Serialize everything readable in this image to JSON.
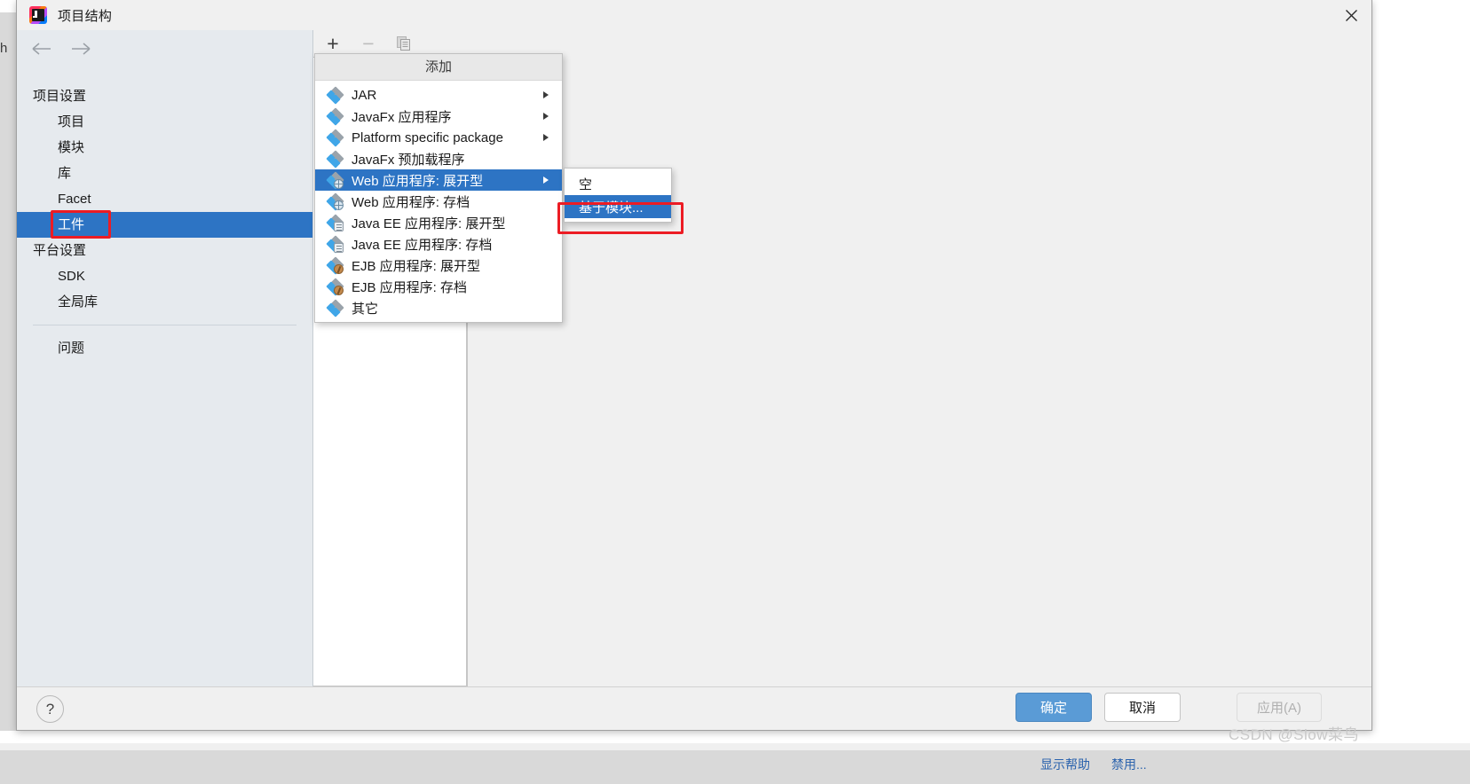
{
  "window": {
    "title": "项目结构",
    "app_icon": "intellij-idea-icon",
    "close_label": "✕"
  },
  "sidebar": {
    "back_icon": "arrow-left-icon",
    "forward_icon": "arrow-right-icon",
    "groups": [
      {
        "label": "项目设置",
        "items": [
          {
            "label": "项目",
            "selected": false
          },
          {
            "label": "模块",
            "selected": false
          },
          {
            "label": "库",
            "selected": false
          },
          {
            "label": "Facet",
            "selected": false
          },
          {
            "label": "工件",
            "selected": true,
            "highlight": "red-box"
          }
        ]
      },
      {
        "label": "平台设置",
        "items": [
          {
            "label": "SDK",
            "selected": false
          },
          {
            "label": "全局库",
            "selected": false
          }
        ]
      }
    ],
    "footer_items": [
      {
        "label": "问题",
        "selected": false
      }
    ]
  },
  "toolbar": {
    "add_icon": "plus-icon",
    "add_label": "+",
    "remove_icon": "minus-icon",
    "remove_label": "−",
    "copy_icon": "copy-icon"
  },
  "menu": {
    "header": "添加",
    "items": [
      {
        "label": "JAR",
        "icon": "artifact-icon",
        "badge": "none",
        "has_submenu": true,
        "selected": false
      },
      {
        "label": "JavaFx 应用程序",
        "icon": "artifact-icon",
        "badge": "none",
        "has_submenu": true,
        "selected": false
      },
      {
        "label": "Platform specific package",
        "icon": "artifact-icon",
        "badge": "none",
        "has_submenu": true,
        "selected": false
      },
      {
        "label": "JavaFx 预加载程序",
        "icon": "artifact-icon",
        "badge": "none",
        "has_submenu": false,
        "selected": false
      },
      {
        "label": "Web 应用程序: 展开型",
        "icon": "artifact-web-icon",
        "badge": "globe",
        "has_submenu": true,
        "selected": true
      },
      {
        "label": "Web 应用程序: 存档",
        "icon": "artifact-web-icon",
        "badge": "globe",
        "has_submenu": false,
        "selected": false
      },
      {
        "label": "Java EE 应用程序: 展开型",
        "icon": "artifact-javaee-icon",
        "badge": "ee",
        "has_submenu": false,
        "selected": false
      },
      {
        "label": "Java EE 应用程序: 存档",
        "icon": "artifact-javaee-icon",
        "badge": "ee",
        "has_submenu": false,
        "selected": false
      },
      {
        "label": "EJB 应用程序: 展开型",
        "icon": "artifact-ejb-icon",
        "badge": "bean",
        "has_submenu": false,
        "selected": false
      },
      {
        "label": "EJB 应用程序: 存档",
        "icon": "artifact-ejb-icon",
        "badge": "bean",
        "has_submenu": false,
        "selected": false
      },
      {
        "label": "其它",
        "icon": "artifact-icon",
        "badge": "none",
        "has_submenu": false,
        "selected": false
      }
    ]
  },
  "submenu": {
    "items": [
      {
        "label": "空",
        "selected": false
      },
      {
        "label": "基于模块...",
        "selected": true,
        "highlight": "red-box"
      }
    ]
  },
  "footer": {
    "help_label": "?",
    "help_icon": "question-mark-icon",
    "ok_label": "确定",
    "cancel_label": "取消",
    "apply_label": "应用(A)"
  },
  "watermark": "CSDN @Slow菜鸟",
  "background": {
    "left_edge_text": "h",
    "status_items": [
      "显示帮助",
      "禁用..."
    ]
  },
  "colors": {
    "selection_blue": "#2d74c4",
    "highlight_red": "#ec1c24",
    "ok_button_blue": "#5a9bd6",
    "sidebar_bg": "#e6eaee",
    "dialog_bg": "#f0f0f0"
  }
}
